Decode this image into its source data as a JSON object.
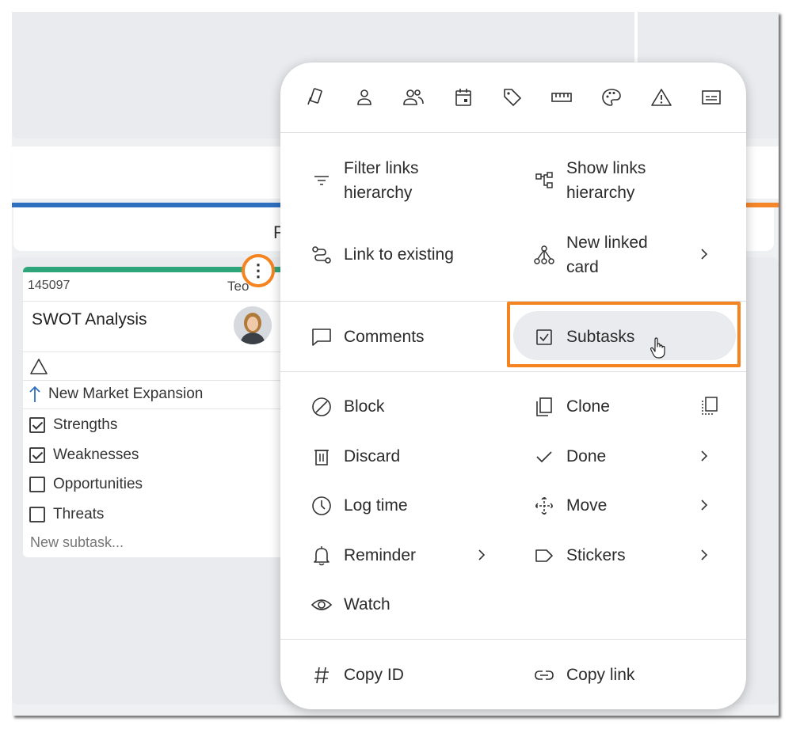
{
  "board": {
    "lane_letter": "F",
    "colors": {
      "lane_blue": "#2f6fc0",
      "lane_orange": "#f5872a",
      "card_green": "#2ea57a",
      "highlight_orange": "#f5831f"
    }
  },
  "card": {
    "id": "145097",
    "owner": "Teo",
    "title": "SWOT Analysis",
    "parent_link": "New Market Expansion",
    "subtasks": [
      {
        "label": "Strengths",
        "checked": true
      },
      {
        "label": "Weaknesses",
        "checked": true
      },
      {
        "label": "Opportunities",
        "checked": false
      },
      {
        "label": "Threats",
        "checked": false
      }
    ],
    "new_subtask_placeholder": "New subtask...",
    "menu_button": "⋮"
  },
  "menu": {
    "toolbar_icons": [
      "card-type-icon",
      "owner-icon",
      "co-owners-icon",
      "deadline-icon",
      "tags-icon",
      "size-icon",
      "color-icon",
      "priority-icon",
      "custom-fields-icon"
    ],
    "filter_links": "Filter links hierarchy",
    "show_links": "Show links hierarchy",
    "link_existing": "Link to existing",
    "new_linked_card": "New linked card",
    "comments": "Comments",
    "subtasks": "Subtasks",
    "block": "Block",
    "clone": "Clone",
    "discard": "Discard",
    "done": "Done",
    "log_time": "Log time",
    "move": "Move",
    "reminder": "Reminder",
    "stickers": "Stickers",
    "watch": "Watch",
    "copy_id": "Copy ID",
    "copy_link": "Copy link"
  }
}
